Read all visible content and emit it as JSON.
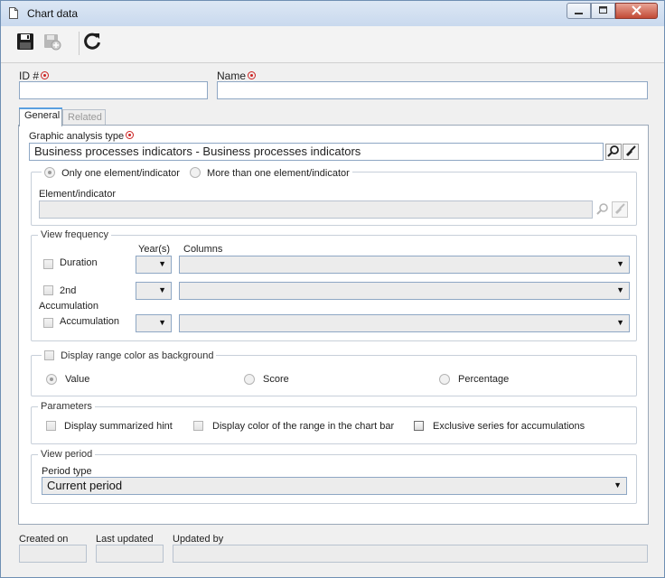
{
  "window": {
    "title": "Chart data",
    "controls": [
      "minimize-icon",
      "maximize-icon",
      "close-icon"
    ]
  },
  "toolbar": {
    "buttons": [
      {
        "name": "save-button",
        "icon": "save-icon",
        "enabled": true
      },
      {
        "name": "save-and-new-button",
        "icon": "save-new-icon",
        "enabled": false
      },
      {
        "name": "refresh-button",
        "icon": "refresh-icon",
        "enabled": true
      }
    ]
  },
  "fields": {
    "id_label": "ID #",
    "id_value": "",
    "name_label": "Name",
    "name_value": ""
  },
  "tabs": [
    {
      "label": "General",
      "active": true
    },
    {
      "label": "Related",
      "active": false
    }
  ],
  "general": {
    "graphic_type_label": "Graphic analysis type",
    "graphic_type_value": "Business processes indicators - Business processes indicators",
    "element_mode": {
      "one_label": "Only one element/indicator",
      "many_label": "More than one element/indicator",
      "selected": "one"
    },
    "element_label": "Element/indicator",
    "element_value": "",
    "view_frequency": {
      "legend": "View frequency",
      "year_header": "Year(s)",
      "columns_header": "Columns",
      "rows": [
        {
          "label": "Duration",
          "year": "",
          "columns": ""
        },
        {
          "label": "2nd Accumulation",
          "year": "",
          "columns": ""
        },
        {
          "label": "Accumulation",
          "year": "",
          "columns": ""
        }
      ]
    },
    "range_color": {
      "legend": "Display range color as background",
      "options": [
        "Value",
        "Score",
        "Percentage"
      ],
      "selected": "Value"
    },
    "parameters": {
      "legend": "Parameters",
      "options": [
        "Display summarized hint",
        "Display color of the range in the chart bar",
        "Exclusive series for accumulations"
      ]
    },
    "view_period": {
      "legend": "View period",
      "period_type_label": "Period type",
      "period_type_value": "Current period"
    }
  },
  "footer": {
    "created_on_label": "Created on",
    "created_on_value": "",
    "last_updated_label": "Last updated",
    "last_updated_value": "",
    "updated_by_label": "Updated by",
    "updated_by_value": ""
  },
  "colors": {
    "title_bar": "#c9d9ee",
    "required_marker": "#cc2222",
    "field_border": "#8ea7c4",
    "close_button": "#c24a35"
  }
}
